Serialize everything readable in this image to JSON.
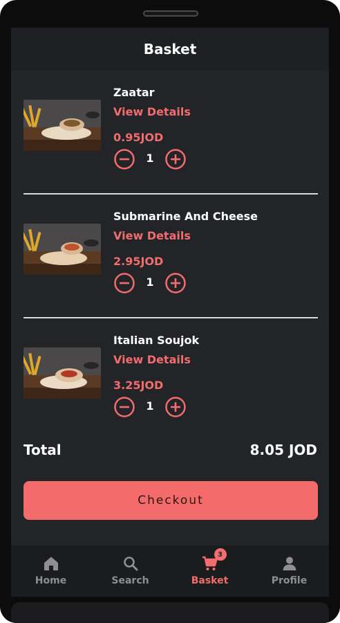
{
  "header": {
    "title": "Basket"
  },
  "colors": {
    "accent": "#f26d6d",
    "background": "#232427",
    "header": "#1f2023",
    "nav": "#1b1c1e"
  },
  "basket": {
    "items": [
      {
        "name": "Zaatar",
        "details_label": "View Details",
        "price": "0.95JOD",
        "quantity": "1",
        "image": "wrap-zaatar-photo"
      },
      {
        "name": "Submarine And Cheese",
        "details_label": "View Details",
        "price": "2.95JOD",
        "quantity": "1",
        "image": "wrap-submarine-photo"
      },
      {
        "name": "Italian Soujok",
        "details_label": "View Details",
        "price": "3.25JOD",
        "quantity": "1",
        "image": "wrap-soujok-photo"
      }
    ]
  },
  "summary": {
    "total_label": "Total",
    "total_value": "8.05 JOD"
  },
  "checkout": {
    "label": "Checkout"
  },
  "nav": {
    "items": [
      {
        "label": "Home",
        "icon": "home-icon",
        "active": false
      },
      {
        "label": "Search",
        "icon": "search-icon",
        "active": false
      },
      {
        "label": "Basket",
        "icon": "cart-icon",
        "active": true,
        "badge": "3"
      },
      {
        "label": "Profile",
        "icon": "person-icon",
        "active": false
      }
    ]
  }
}
